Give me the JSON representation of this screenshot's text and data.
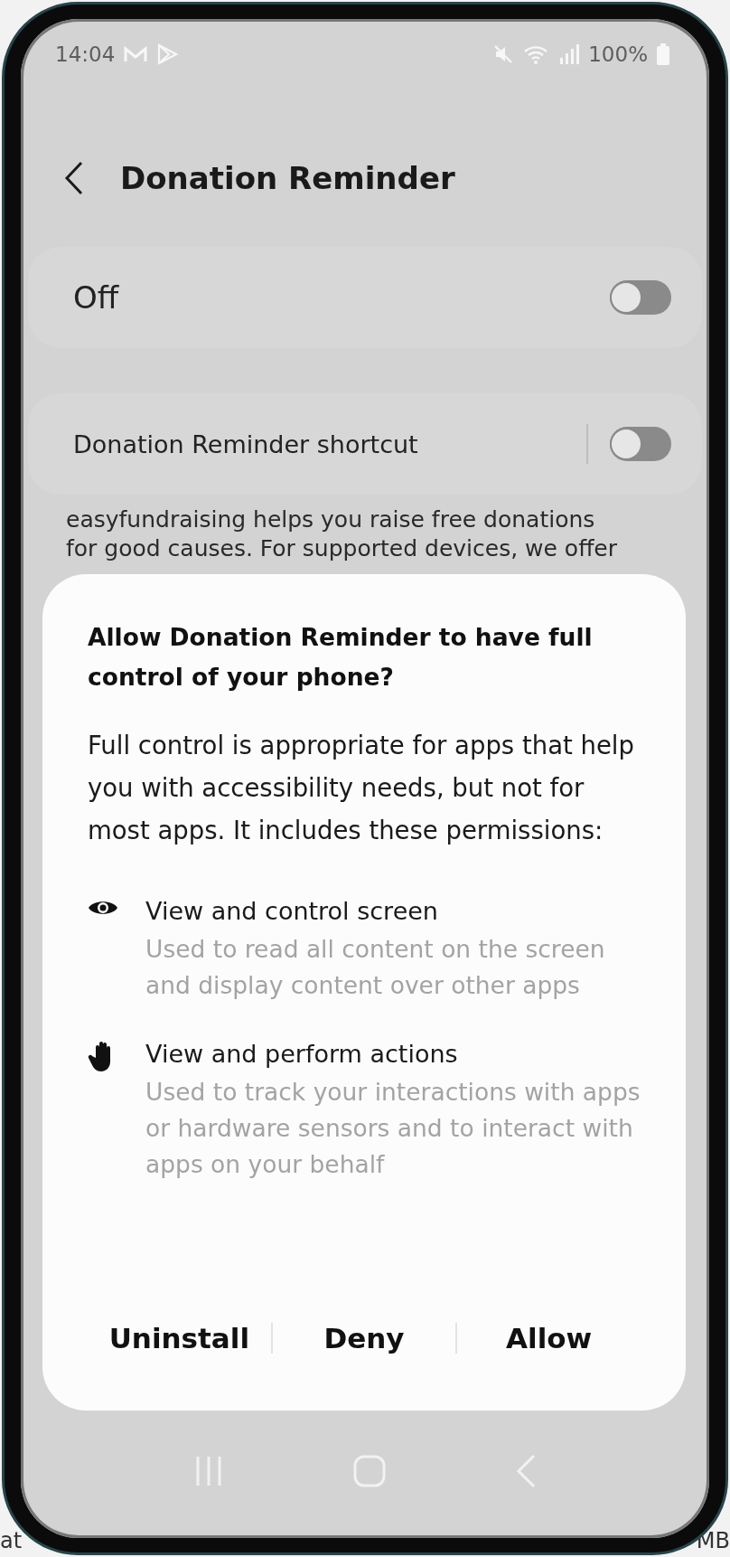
{
  "status_bar": {
    "time": "14:04",
    "battery": "100%"
  },
  "header": {
    "title": "Donation Reminder"
  },
  "settings": [
    {
      "label": "Off",
      "kind": "main",
      "on": false
    },
    {
      "label": "Donation Reminder shortcut",
      "kind": "shortcut",
      "on": false
    }
  ],
  "description": {
    "lines": [
      "easyfundraising helps you raise free donations",
      "for good causes. For supported devices, we offer"
    ]
  },
  "dialog": {
    "title": "Allow Donation Reminder to have full control of your phone?",
    "body": "Full control is appropriate for apps that help you with accessibility needs, but not for most apps. It includes these permissions:",
    "permissions": [
      {
        "kind": "eye",
        "title": "View and control screen",
        "description": "Used to read all content on the screen and display content over other apps"
      },
      {
        "kind": "hand",
        "title": "View and perform actions",
        "description": "Used to track your interactions with apps or hardware sensors and to interact with apps on your behalf"
      }
    ],
    "buttons": [
      "Uninstall",
      "Deny",
      "Allow"
    ]
  },
  "background_page": {
    "left_text": "at",
    "right_text": "MB"
  }
}
